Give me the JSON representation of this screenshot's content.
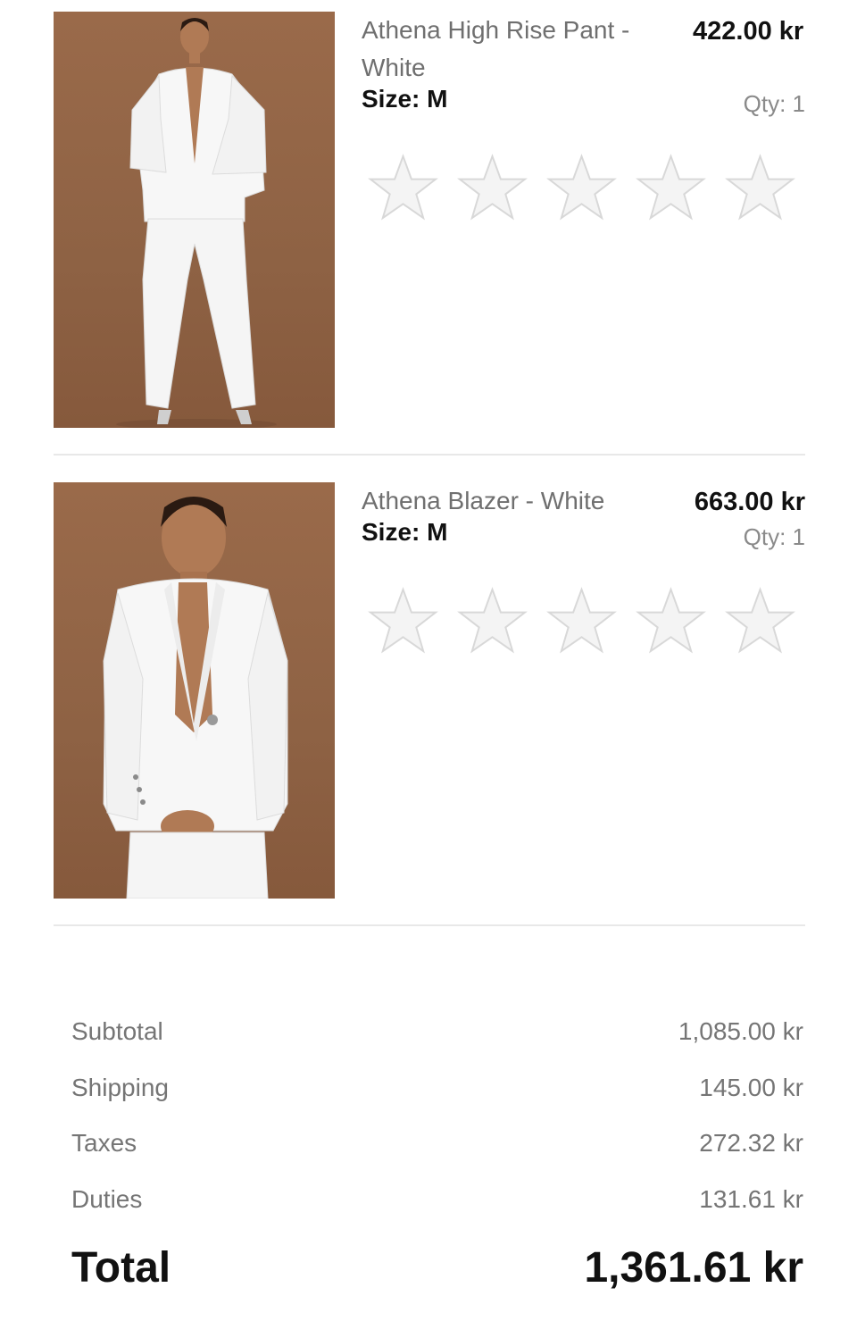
{
  "items": [
    {
      "name": "Athena High Rise Pant - White",
      "size": "Size: M",
      "price": "422.00 kr",
      "qty": "Qty: 1",
      "rating_stars": 5,
      "rating_value": 0,
      "image": "model-white-suit-full-body"
    },
    {
      "name": "Athena Blazer - White",
      "size": "Size: M",
      "price": "663.00 kr",
      "qty": "Qty: 1",
      "rating_stars": 5,
      "rating_value": 0,
      "image": "model-white-blazer-upper-body"
    }
  ],
  "summary": {
    "subtotal_label": "Subtotal",
    "subtotal_value": "1,085.00 kr",
    "shipping_label": "Shipping",
    "shipping_value": "145.00 kr",
    "taxes_label": "Taxes",
    "taxes_value": "272.32 kr",
    "duties_label": "Duties",
    "duties_value": "131.61 kr",
    "total_label": "Total",
    "total_value": "1,361.61 kr"
  },
  "colors": {
    "star_fill": "#f4f4f4",
    "star_stroke": "#d8d8d8",
    "photo_background": "#8e6244"
  }
}
